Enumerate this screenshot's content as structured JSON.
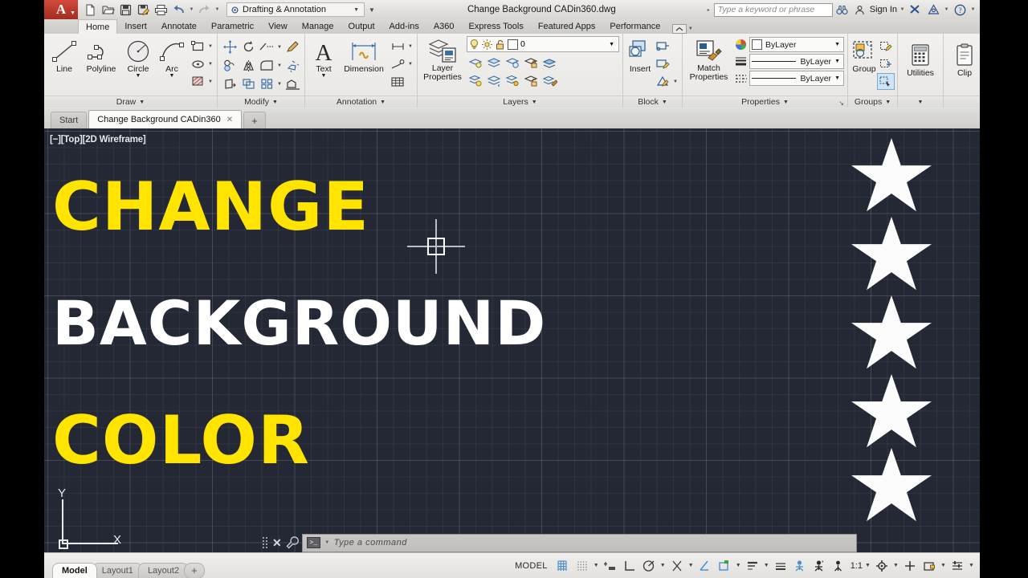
{
  "app": {
    "logo": "A",
    "title": "Change Background CADin360.dwg",
    "workspace": "Drafting & Annotation",
    "search_placeholder": "Type a keyword or phrase",
    "sign_in": "Sign In"
  },
  "quick_access": [
    {
      "name": "new-drawing",
      "icon": "page-icon"
    },
    {
      "name": "open-drawing",
      "icon": "folder-icon"
    },
    {
      "name": "save",
      "icon": "floppy-icon"
    },
    {
      "name": "save-as",
      "icon": "floppy-pencil-icon"
    },
    {
      "name": "plot",
      "icon": "printer-icon"
    },
    {
      "name": "undo",
      "icon": "undo-arrow-icon"
    },
    {
      "name": "redo",
      "icon": "redo-arrow-icon"
    }
  ],
  "ribbon_tabs": [
    {
      "label": "Home",
      "active": true
    },
    {
      "label": "Insert",
      "active": false
    },
    {
      "label": "Annotate",
      "active": false
    },
    {
      "label": "Parametric",
      "active": false
    },
    {
      "label": "View",
      "active": false
    },
    {
      "label": "Manage",
      "active": false
    },
    {
      "label": "Output",
      "active": false
    },
    {
      "label": "Add-ins",
      "active": false
    },
    {
      "label": "A360",
      "active": false
    },
    {
      "label": "Express Tools",
      "active": false
    },
    {
      "label": "Featured Apps",
      "active": false
    },
    {
      "label": "Performance",
      "active": false
    }
  ],
  "panels": {
    "draw": {
      "title": "Draw",
      "buttons": [
        {
          "label": "Line",
          "icon": "line-icon"
        },
        {
          "label": "Polyline",
          "icon": "polyline-icon"
        },
        {
          "label": "Circle",
          "icon": "circle-icon"
        },
        {
          "label": "Arc",
          "icon": "arc-icon"
        }
      ],
      "small": [
        {
          "name": "rectangle-icon"
        },
        {
          "name": "ellipse-icon"
        },
        {
          "name": "hatch-icon"
        }
      ]
    },
    "modify": {
      "title": "Modify",
      "small": [
        {
          "name": "move-icon"
        },
        {
          "name": "rotate-icon"
        },
        {
          "name": "trim-icon"
        },
        {
          "name": "erase-icon"
        },
        {
          "name": "copy-icon"
        },
        {
          "name": "mirror-icon"
        },
        {
          "name": "fillet-icon"
        },
        {
          "name": "explode-icon"
        },
        {
          "name": "stretch-icon"
        },
        {
          "name": "scale-icon"
        },
        {
          "name": "array-icon"
        },
        {
          "name": "offset-icon"
        }
      ]
    },
    "annotation": {
      "title": "Annotation",
      "buttons": [
        {
          "label": "Text",
          "icon": "text-a-icon"
        },
        {
          "label": "Dimension",
          "icon": "dimension-icon"
        }
      ],
      "small": [
        {
          "name": "dimension-style-icon"
        },
        {
          "name": "leader-icon"
        },
        {
          "name": "table-icon"
        }
      ]
    },
    "layers": {
      "title": "Layers",
      "big_label_line1": "Layer",
      "big_label_line2": "Properties",
      "current_layer": "0",
      "small": [
        {
          "name": "layer-isolate-icon"
        },
        {
          "name": "layer-freeze-icon"
        },
        {
          "name": "layer-off-icon"
        },
        {
          "name": "layer-lock-icon"
        },
        {
          "name": "layer-merge-icon"
        },
        {
          "name": "layer-on-icon"
        },
        {
          "name": "layer-unisolate-icon"
        },
        {
          "name": "layer-thaw-icon"
        },
        {
          "name": "layer-unlock-icon"
        },
        {
          "name": "layer-match-icon"
        }
      ]
    },
    "block": {
      "title": "Block",
      "buttons": [
        {
          "label": "Insert",
          "icon": "insert-block-icon"
        }
      ],
      "small": [
        {
          "name": "create-block-icon"
        },
        {
          "name": "edit-block-icon"
        },
        {
          "name": "edit-attribute-icon"
        }
      ]
    },
    "properties": {
      "title": "Properties",
      "big_label_line1": "Match",
      "big_label_line2": "Properties",
      "rows": [
        {
          "icon": "color-wheel-icon",
          "value": "ByLayer"
        },
        {
          "icon": "lineweight-icon",
          "value": "ByLayer"
        },
        {
          "icon": "linetype-icon",
          "value": "ByLayer"
        }
      ]
    },
    "groups": {
      "title": "Groups",
      "buttons": [
        {
          "label": "Group",
          "icon": "group-icon"
        }
      ],
      "small": [
        {
          "name": "edit-group-icon"
        },
        {
          "name": "ungroup-icon"
        },
        {
          "name": "group-selection-on-icon"
        }
      ]
    },
    "utilities": {
      "title": "",
      "buttons": [
        {
          "label": "Utilities",
          "icon": "calculator-icon"
        }
      ]
    },
    "clipboard": {
      "title": "",
      "buttons": [
        {
          "label": "Clip",
          "icon": "clipboard-icon"
        }
      ]
    }
  },
  "file_tabs": [
    {
      "label": "Start",
      "active": false,
      "closable": false
    },
    {
      "label": "Change Background CADin360",
      "active": true,
      "closable": true
    }
  ],
  "file_tab_new": "+",
  "viewport": {
    "label": "[−][Top][2D Wireframe]",
    "background_color": "#232834",
    "lines": [
      {
        "text": "CHANGE",
        "color": "#FFE400"
      },
      {
        "text": "BACKGROUND",
        "color": "#FFFFFF"
      },
      {
        "text": "COLOR",
        "color": "#FFE400"
      }
    ],
    "stars_count": 5,
    "star_color": "#FCFCFC",
    "ucs": {
      "x_label": "X",
      "y_label": "Y"
    }
  },
  "command_line": {
    "placeholder": "Type a command",
    "prompt": ">_"
  },
  "layout_tabs": [
    {
      "label": "Model",
      "active": true
    },
    {
      "label": "Layout1",
      "active": false
    },
    {
      "label": "Layout2",
      "active": false
    }
  ],
  "layout_tab_new": "+",
  "status_bar": {
    "space_label": "MODEL",
    "scale": "1:1",
    "icons": [
      {
        "name": "grid-display-icon"
      },
      {
        "name": "snap-mode-icon"
      },
      {
        "name": "infer-constraints-icon"
      },
      {
        "name": "ortho-mode-icon"
      },
      {
        "name": "polar-tracking-icon"
      },
      {
        "name": "object-snap-icon"
      },
      {
        "name": "object-snap-tracking-icon"
      },
      {
        "name": "dynamic-ucs-icon"
      },
      {
        "name": "lineweight-icon"
      },
      {
        "name": "transparency-icon"
      },
      {
        "name": "selection-cycling-icon"
      },
      {
        "name": "annotation-monitor-icon"
      },
      {
        "name": "annotation-visibility-icon"
      },
      {
        "name": "autoscale-icon"
      },
      {
        "name": "workspace-switching-icon"
      },
      {
        "name": "hardware-acceleration-icon"
      },
      {
        "name": "isolate-objects-icon"
      },
      {
        "name": "customization-icon"
      }
    ]
  }
}
